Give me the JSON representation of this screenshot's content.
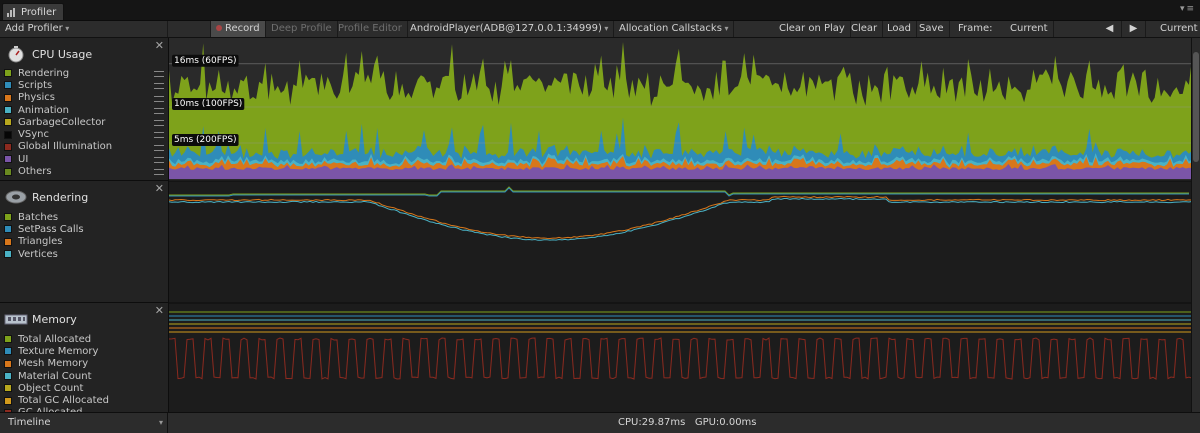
{
  "window": {
    "tab_title": "Profiler"
  },
  "toolbar": {
    "add_profiler": "Add Profiler",
    "record": "Record",
    "deep_profile": "Deep Profile",
    "profile_editor": "Profile Editor",
    "target": "AndroidPlayer(ADB@127.0.0.1:34999)",
    "allocation_callstacks": "Allocation Callstacks",
    "clear_on_play": "Clear on Play",
    "clear": "Clear",
    "load": "Load",
    "save": "Save",
    "frame_label": "Frame:",
    "frame_value": "Current",
    "current_button": "Current"
  },
  "sections": {
    "cpu": {
      "title": "CPU Usage",
      "items": [
        {
          "label": "Rendering",
          "color": "#7ea21b"
        },
        {
          "label": "Scripts",
          "color": "#2f8cb8"
        },
        {
          "label": "Physics",
          "color": "#d8771b"
        },
        {
          "label": "Animation",
          "color": "#4ab2c5"
        },
        {
          "label": "GarbageCollector",
          "color": "#b8a81e"
        },
        {
          "label": "VSync",
          "color": "#060606"
        },
        {
          "label": "Global Illumination",
          "color": "#8c2a1f"
        },
        {
          "label": "UI",
          "color": "#7b55a8"
        },
        {
          "label": "Others",
          "color": "#6a8a20"
        }
      ],
      "markers": [
        {
          "label": "16ms (60FPS)",
          "ms": 16
        },
        {
          "label": "10ms (100FPS)",
          "ms": 10
        },
        {
          "label": "5ms (200FPS)",
          "ms": 5
        }
      ]
    },
    "rendering": {
      "title": "Rendering",
      "items": [
        {
          "label": "Batches",
          "color": "#7ea21b"
        },
        {
          "label": "SetPass Calls",
          "color": "#2f8cb8"
        },
        {
          "label": "Triangles",
          "color": "#d8771b"
        },
        {
          "label": "Vertices",
          "color": "#4ab2c5"
        }
      ]
    },
    "memory": {
      "title": "Memory",
      "items": [
        {
          "label": "Total Allocated",
          "color": "#7ea21b"
        },
        {
          "label": "Texture Memory",
          "color": "#2f8cb8"
        },
        {
          "label": "Mesh Memory",
          "color": "#d8771b"
        },
        {
          "label": "Material Count",
          "color": "#4ab2c5"
        },
        {
          "label": "Object Count",
          "color": "#b8a81e"
        },
        {
          "label": "Total GC Allocated",
          "color": "#d29a1c"
        },
        {
          "label": "GC Allocated",
          "color": "#8c2a1f"
        }
      ]
    }
  },
  "bottom": {
    "view_mode": "Timeline",
    "cpu_stat": "CPU:29.87ms",
    "gpu_stat": "GPU:0.00ms"
  }
}
